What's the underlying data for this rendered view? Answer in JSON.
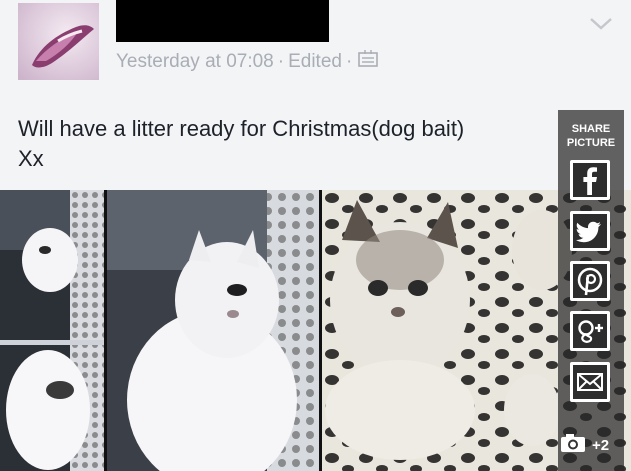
{
  "post": {
    "timestamp": "Yesterday at 07:08",
    "edited_label": "Edited",
    "separator": "·",
    "text": "Will have a litter ready for Christmas(dog bait)\nXx"
  },
  "share": {
    "label": "SHARE\nPICTURE",
    "buttons": [
      "facebook",
      "twitter",
      "pinterest",
      "google-plus",
      "email"
    ],
    "photo_count": "+2"
  },
  "icons": [
    "globe-icon",
    "chevron-down-icon",
    "facebook-icon",
    "twitter-icon",
    "pinterest-icon",
    "google-plus-icon",
    "email-icon",
    "camera-icon"
  ]
}
